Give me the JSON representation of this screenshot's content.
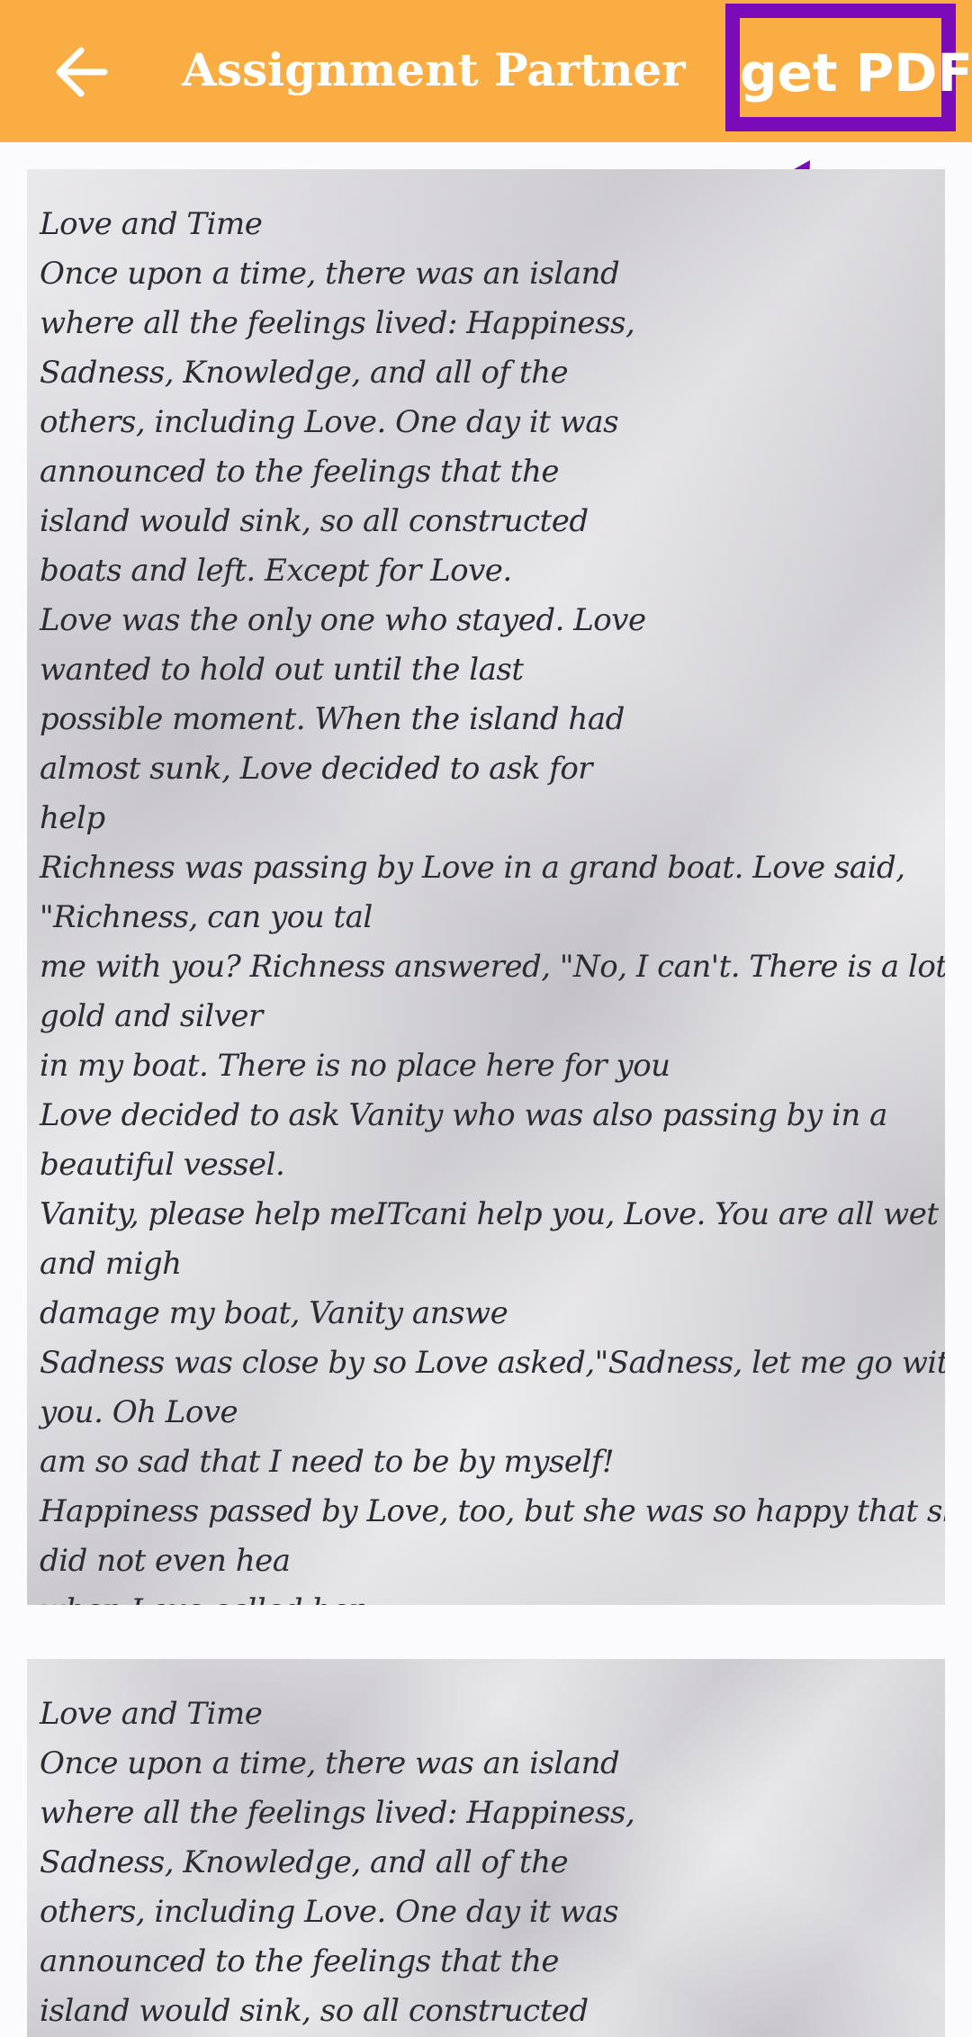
{
  "app_bar": {
    "title": "Assignment Partner",
    "back_icon": "arrow-left-icon",
    "pdf_button_label": "get PDF",
    "background_color": "#f9ad43",
    "highlight_color": "#7b0bb8"
  },
  "pages": [
    {
      "lines": [
        "Love and Time",
        "Once upon a time, there was an island",
        "where all the feelings lived: Happiness,",
        "Sadness, Knowledge, and all of the",
        "others, including Love. One day it was",
        "announced to the feelings that the",
        "island would sink, so all constructed",
        "boats and left. Except for Love.",
        "Love was the only one who stayed. Love",
        "wanted to hold out until the last",
        "possible moment. When the island had",
        "almost sunk, Love decided to ask for",
        "help",
        "Richness was passing by Love in a grand boat. Love said,",
        "\"Richness, can you tal",
        "me with you? Richness answered, \"No, I can't. There is a lot of",
        "gold and silver",
        "in my boat. There is no place here for you",
        "Love decided to ask Vanity who was also passing by in a",
        "beautiful vessel.",
        "Vanity, please help meITcani help you, Love. You are all wet",
        "and migh",
        "damage my boat, Vanity answe",
        "Sadness was close by so Love asked,\"Sadness, let me go with",
        "you. Oh Love",
        "am so sad that I need to be by myself!",
        "Happiness passed by Love, too, but she was so happy that she",
        "did not even hea",
        "when Love called her"
      ]
    },
    {
      "lines": [
        "Love and Time",
        "Once upon a time, there was an island",
        "where all the feelings lived: Happiness,",
        "Sadness, Knowledge, and all of the",
        "others, including Love. One day it was",
        "announced to the feelings that the",
        "island would sink, so all constructed"
      ]
    }
  ]
}
